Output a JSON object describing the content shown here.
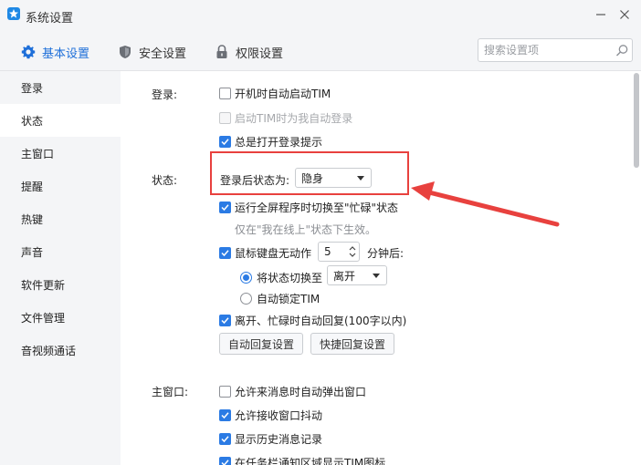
{
  "window": {
    "title": "系统设置"
  },
  "tabs": [
    {
      "label": "基本设置",
      "icon": "gear-icon"
    },
    {
      "label": "安全设置",
      "icon": "shield-icon"
    },
    {
      "label": "权限设置",
      "icon": "lock-icon"
    }
  ],
  "search": {
    "placeholder": "搜索设置项",
    "value": ""
  },
  "sidebar": {
    "items": [
      {
        "label": "登录"
      },
      {
        "label": "状态"
      },
      {
        "label": "主窗口"
      },
      {
        "label": "提醒"
      },
      {
        "label": "热键"
      },
      {
        "label": "声音"
      },
      {
        "label": "软件更新"
      },
      {
        "label": "文件管理"
      },
      {
        "label": "音视频通话"
      }
    ],
    "active": "状态"
  },
  "login": {
    "section_label": "登录:",
    "options": [
      {
        "label": "开机时自动启动TIM",
        "checked": false,
        "disabled": false
      },
      {
        "label": "启动TIM时为我自动登录",
        "checked": false,
        "disabled": true
      },
      {
        "label": "总是打开登录提示",
        "checked": true,
        "disabled": false
      }
    ]
  },
  "status": {
    "section_label": "状态:",
    "after_login_label": "登录后状态为:",
    "after_login_value": "隐身",
    "fullscreen_label": "运行全屏程序时切换至\"忙碌\"状态",
    "fullscreen_checked": true,
    "fullscreen_hint": "仅在\"我在线上\"状态下生效。",
    "idle_label": "鼠标键盘无动作",
    "idle_checked": true,
    "idle_minutes": "5",
    "idle_suffix": "分钟后:",
    "switch_label": "将状态切换至",
    "switch_checked": true,
    "switch_value": "离开",
    "autolock_label": "自动锁定TIM",
    "autolock_checked": false,
    "autoreply_label": "离开、忙碌时自动回复(100字以内)",
    "autoreply_checked": true,
    "autoreply_button": "自动回复设置",
    "quickreply_button": "快捷回复设置"
  },
  "main_window": {
    "section_label": "主窗口:",
    "options": [
      {
        "label": "允许来消息时自动弹出窗口",
        "checked": false
      },
      {
        "label": "允许接收窗口抖动",
        "checked": true
      },
      {
        "label": "显示历史消息记录",
        "checked": true
      },
      {
        "label": "在任务栏通知区域显示TIM图标",
        "checked": true
      }
    ]
  },
  "colors": {
    "accent": "#2b7be4",
    "annotation": "#e8413e",
    "sidebar_bg": "#f4f5f7"
  }
}
